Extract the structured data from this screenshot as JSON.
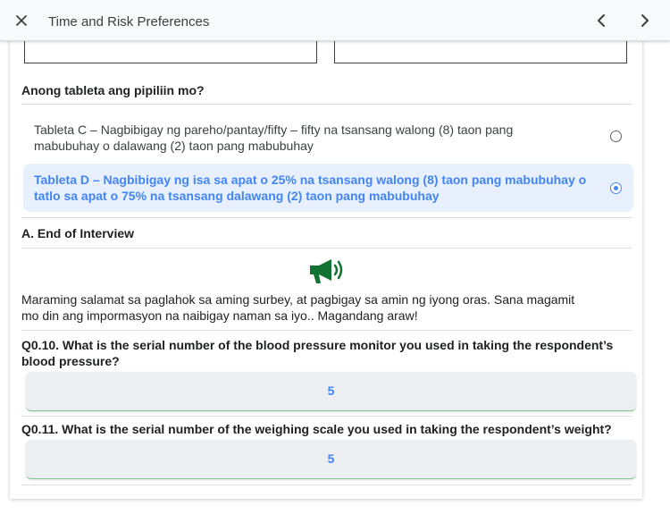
{
  "header": {
    "title": "Time and Risk Preferences",
    "close_icon": "close-icon",
    "prev_icon": "chevron-left-icon",
    "next_icon": "chevron-right-icon"
  },
  "question_tablet": {
    "text": "Anong tableta ang pipiliin mo?",
    "options": [
      {
        "line1": "Tableta C – Nagbibigay ng pareho/pantay/fifty – fifty na tsansang walong (8) taon pang",
        "line2": "mabubuhay o dalawang (2) taon pang mabubuhay",
        "selected": false
      },
      {
        "line1": "Tableta D – Nagbibigay ng isa sa apat o 25% na tsansang walong (8) taon pang mabubuhay o",
        "line2": "tatlo sa apat o 75% na tsansang dalawang (2) taon pang mabubuhay",
        "selected": true
      }
    ]
  },
  "end_section": {
    "title": "A. End of Interview",
    "speaker_icon": "megaphone-icon",
    "message_line1": "Maraming salamat sa paglahok sa aming surbey, at pagbigay sa amin ng iyong oras. Sana magamit",
    "message_line2": "mo din ang impormasyon na naibigay naman sa iyo.. Magandang araw!"
  },
  "q0_10": {
    "line1": "Q0.10. What is the serial number of the blood pressure monitor you used in taking the respondent’s",
    "line2": "blood pressure?",
    "value": "5"
  },
  "q0_11": {
    "text": "Q0.11. What is the serial number of the weighing scale you used in taking the respondent’s weight?",
    "value": "5"
  },
  "colors": {
    "accent": "#4285f4",
    "selected_bg": "#e8f0fe",
    "speaker": "#137333"
  }
}
